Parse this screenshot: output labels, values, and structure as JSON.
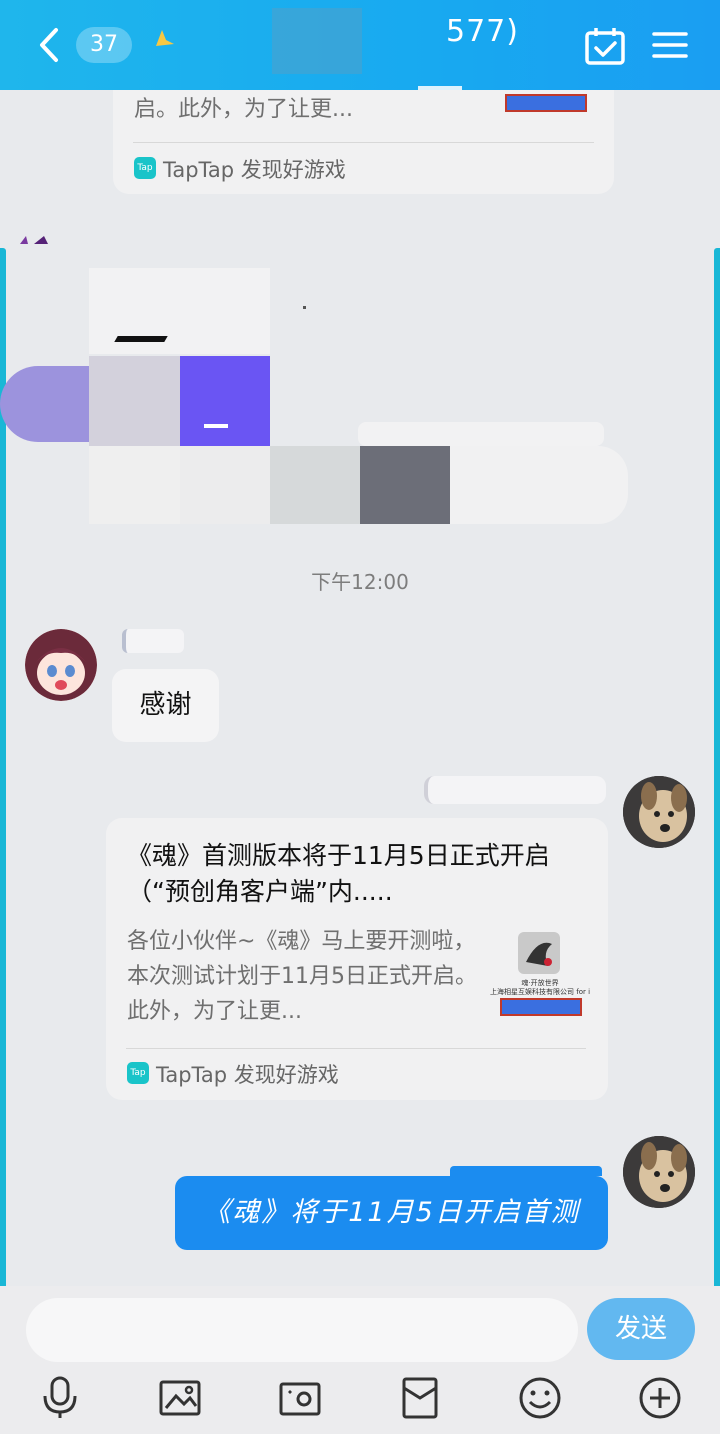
{
  "header": {
    "unread_count": "37",
    "title_fragment": "577)"
  },
  "top_card": {
    "desc_tail": "启。此外，为了让更...",
    "source": "TapTap 发现好游戏",
    "tap_logo": "Tap"
  },
  "timestamp": "下午12:00",
  "incoming": {
    "message": "感谢"
  },
  "share_card": {
    "title": "《魂》首测版本将于11月5日正式开启（“预创角客户端”内.....",
    "desc": "各位小伙伴~《魂》马上要开测啦，本次测试计划于11月5日正式开启。此外，为了让更...",
    "thumb_caption_1": "魂·开放世界",
    "thumb_caption_2": "上海相星互娱科技有限公司 for i",
    "source": "TapTap 发现好游戏",
    "tap_logo": "Tap"
  },
  "outgoing": {
    "message": "《魂》将于11月5日开启首测"
  },
  "input": {
    "send_label": "发送"
  },
  "colors": {
    "header_bg": "#1aaaf0",
    "accent_bar": "#19b7d6",
    "blue_bubble": "#1b8cf0",
    "send_button": "#62b8f0"
  },
  "icons": [
    "back-icon",
    "calendar-icon",
    "menu-icon",
    "microphone-icon",
    "image-icon",
    "camera-icon",
    "red-packet-icon",
    "emoji-icon",
    "plus-icon"
  ]
}
